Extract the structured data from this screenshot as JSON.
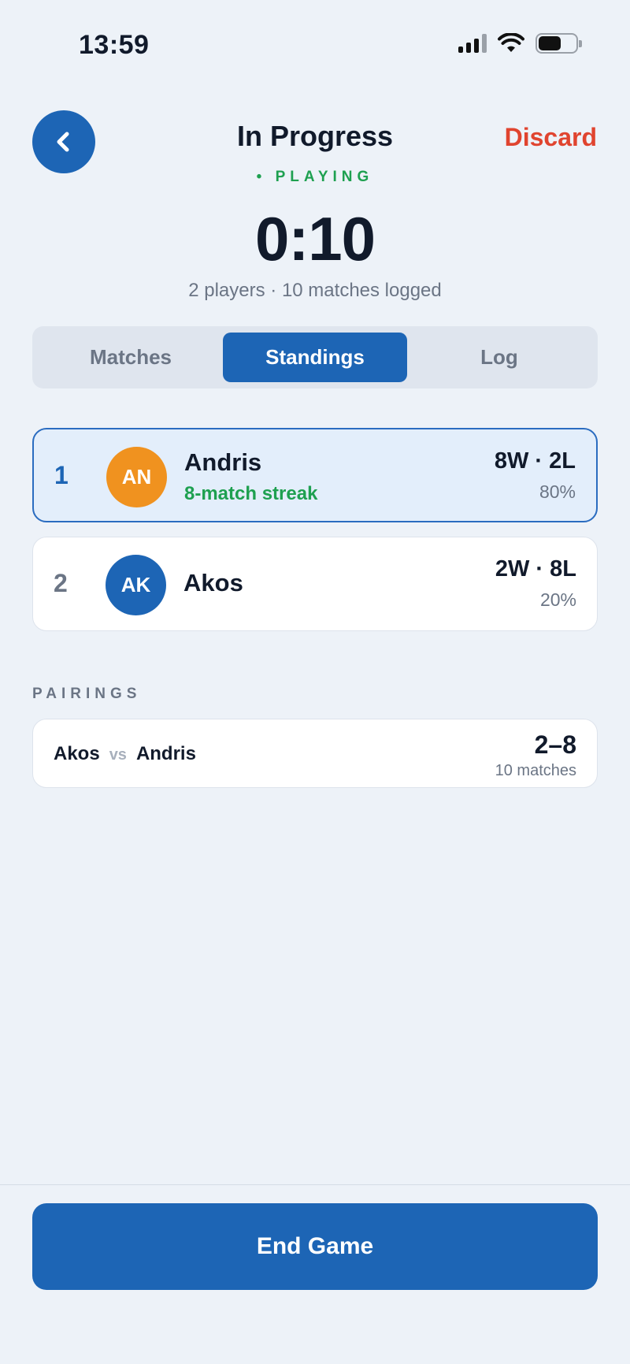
{
  "status_bar": {
    "time": "13:59"
  },
  "header": {
    "title": "In Progress",
    "discard_label": "Discard",
    "state": "• PLAYING",
    "timer": "0:10",
    "summary": "2 players · 10 matches logged"
  },
  "tabs": [
    {
      "label": "Matches",
      "active": false
    },
    {
      "label": "Standings",
      "active": true
    },
    {
      "label": "Log",
      "active": false
    }
  ],
  "standings": [
    {
      "rank": "1",
      "initials": "AN",
      "name": "Andris",
      "streak": "8-match streak",
      "record": "8W · 2L",
      "pct": "80%",
      "avatar_color": "#f0921f"
    },
    {
      "rank": "2",
      "initials": "AK",
      "name": "Akos",
      "streak": "",
      "record": "2W · 8L",
      "pct": "20%",
      "avatar_color": "#1d65b5"
    }
  ],
  "pairings": {
    "label": "PAIRINGS",
    "items": [
      {
        "player_a": "Akos",
        "vs": "vs",
        "player_b": "Andris",
        "score": "2–8",
        "count": "10 matches"
      }
    ]
  },
  "footer": {
    "end_label": "End Game"
  },
  "colors": {
    "accent": "#1d65b5",
    "danger": "#e0442f",
    "success": "#1ea050",
    "leader_avatar": "#f0921f"
  }
}
